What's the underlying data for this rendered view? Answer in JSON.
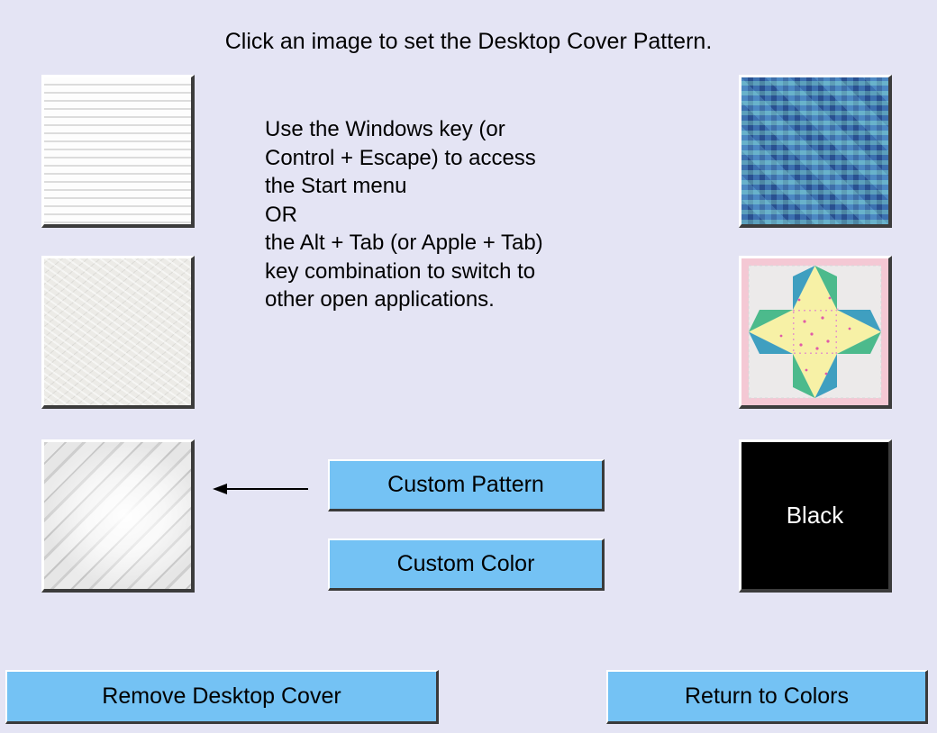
{
  "instruction": "Click an image to set the Desktop Cover Pattern.",
  "help_lines": [
    "Use the Windows key (or",
    "Control + Escape) to access",
    "the Start menu",
    "OR",
    "the Alt + Tab (or Apple + Tab)",
    "key combination to switch to",
    "other open applications."
  ],
  "patterns": {
    "left": [
      {
        "name": "white-lines",
        "color": "#fbfbfb"
      },
      {
        "name": "white-texture",
        "color": "#ecebe7"
      },
      {
        "name": "silver-sheen",
        "color": "#e8e8e8"
      }
    ],
    "right": [
      {
        "name": "blue-weave",
        "color": "#3d6fa8"
      },
      {
        "name": "star-quilt",
        "color": "#f4c8d4"
      },
      {
        "name": "black",
        "label": "Black",
        "color": "#000000"
      }
    ]
  },
  "arrow_icon": "arrow-left-icon",
  "buttons": {
    "custom_pattern": "Custom Pattern",
    "custom_color": "Custom Color",
    "remove_cover": "Remove Desktop Cover",
    "return_colors": "Return to Colors"
  },
  "colors": {
    "background": "#e4e4f4",
    "button": "#74c2f4"
  }
}
